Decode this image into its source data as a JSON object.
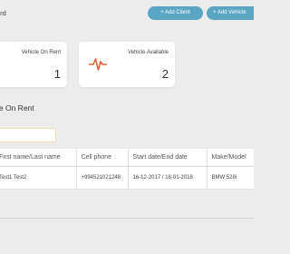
{
  "header": {
    "title": "ard",
    "add_client_label": "+ Add Client",
    "add_vehicle_label": "+ Add Vehicle"
  },
  "cards": {
    "on_rent": {
      "label": "Vehicle On Rent",
      "count": "1"
    },
    "available": {
      "label": "Vehicle Available",
      "count": "2",
      "icon": "pulse-icon",
      "icon_color": "#e0633e"
    }
  },
  "section": {
    "title": "le On Rent"
  },
  "table": {
    "headers": [
      "First name/Last name",
      "Cell phone",
      "Start date/End date",
      "Make/Model"
    ],
    "rows": [
      [
        "Test1 Test2",
        "+994521021248",
        "16-12-2017 / 18-01-2018",
        "BMW 528i"
      ]
    ]
  },
  "colors": {
    "accent": "#5aa5c4",
    "background": "#ececec",
    "search_border": "#f3ddb2"
  }
}
